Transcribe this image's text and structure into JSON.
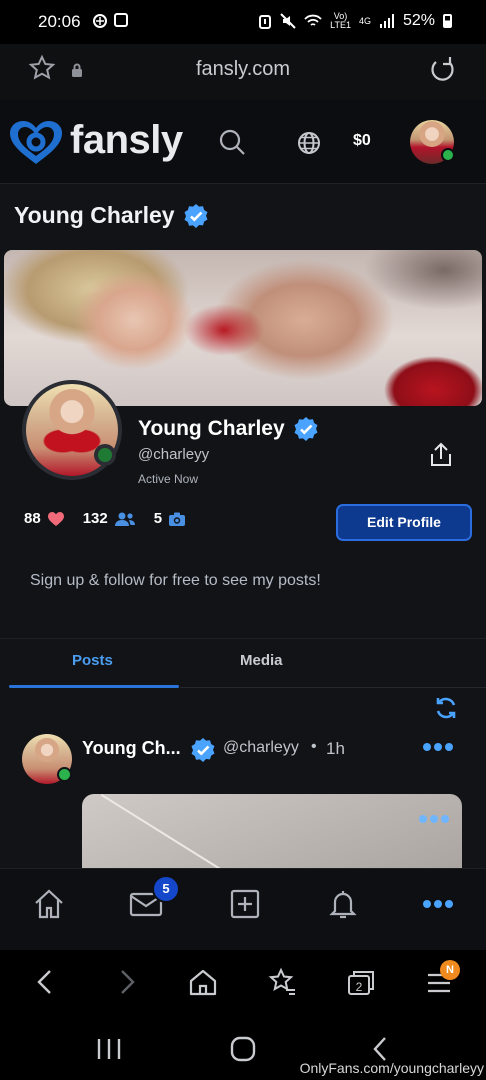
{
  "status_bar": {
    "time": "20:06",
    "network_top": "Vo)",
    "network_bottom": "LTE1",
    "net_type": "4G",
    "battery": "52%"
  },
  "browser": {
    "url": "fansly.com"
  },
  "header": {
    "logo_text": "fansly",
    "balance": "$0"
  },
  "profile": {
    "title": "Young Charley",
    "display_name": "Young Charley",
    "username": "@charleyy",
    "status": "Active Now",
    "likes": "88",
    "followers": "132",
    "media_count": "5",
    "edit_label": "Edit Profile",
    "bio": "Sign up & follow for free to see my posts!"
  },
  "tabs": [
    {
      "label": "Posts",
      "active": true
    },
    {
      "label": "Media",
      "active": false
    }
  ],
  "post": {
    "name": "Young Ch...",
    "handle": "@charleyy",
    "separator": "•",
    "time": "1h"
  },
  "bottom_nav": {
    "messages_badge": "5"
  },
  "browser_nav": {
    "tabs_count": "2",
    "menu_badge": "N"
  },
  "watermark": "OnlyFans.com/youngcharleyy",
  "colors": {
    "accent": "#2a73d9",
    "verified": "#4aa3ff",
    "online": "#2bb24c",
    "like": "#f06a7a"
  }
}
